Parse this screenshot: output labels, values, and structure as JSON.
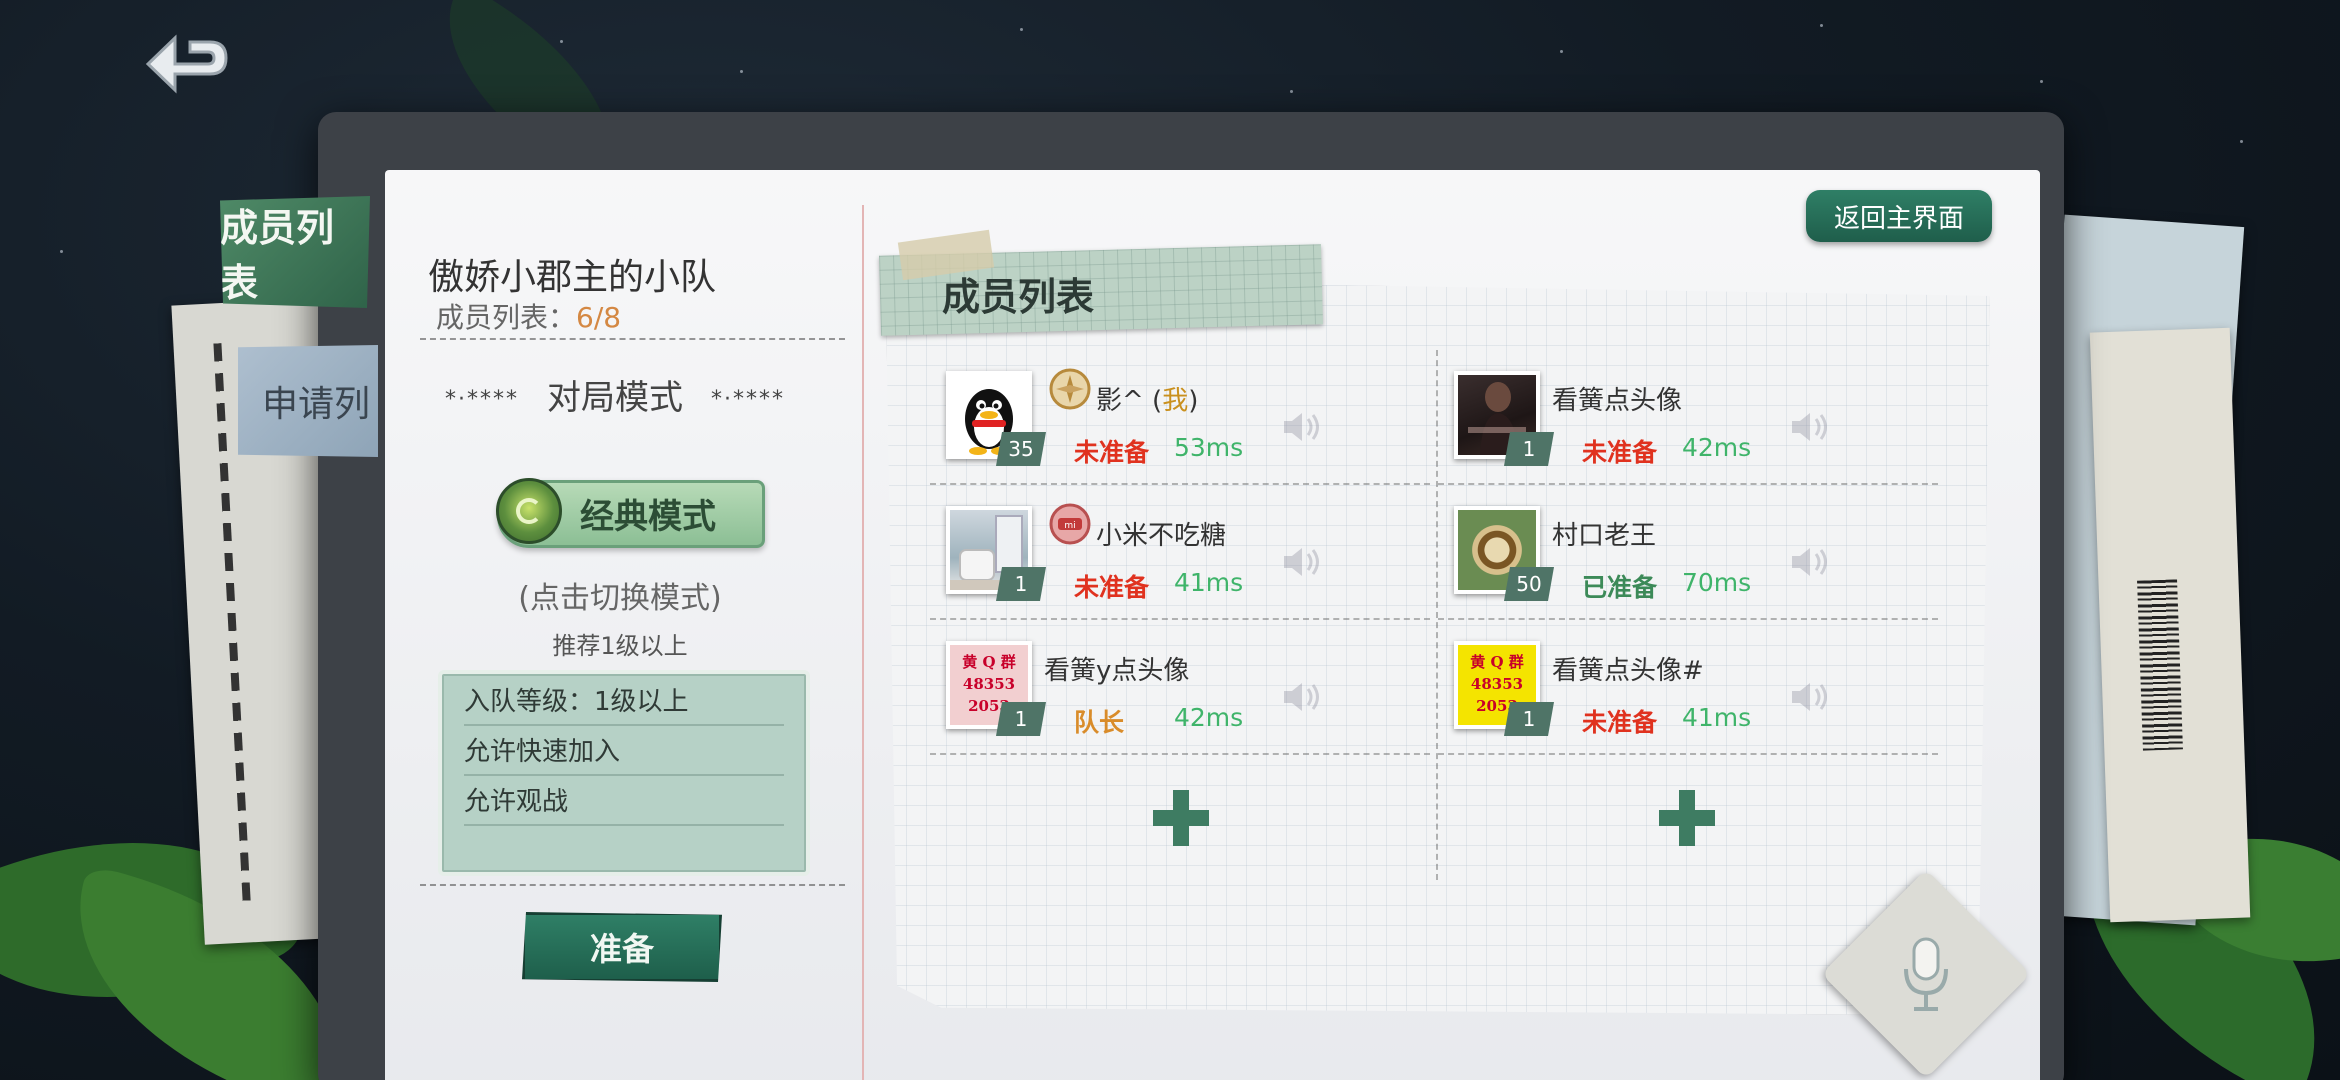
{
  "tabs": {
    "members": "成员列表",
    "apply": "申请列"
  },
  "team": {
    "name": "傲娇小郡主的小队",
    "count_label": "成员列表：",
    "count_value": "6/8"
  },
  "mode": {
    "stars_left": "*·****",
    "title": "对局模式",
    "stars_right": "*·****",
    "current": "经典模式",
    "hint": "(点击切换模式)",
    "recommend": "推荐1级以上"
  },
  "settings": [
    "入队等级：1级以上",
    "允许快速加入",
    "允许观战"
  ],
  "ready_button": "准备",
  "return_main": "返回主界面",
  "card_title": "成员列表",
  "members": [
    {
      "name": "影^ (",
      "me": "我",
      "name_end": ")",
      "level": "35",
      "status": "未准备",
      "ping": "53ms"
    },
    {
      "name": "看簧点头像",
      "level": "1",
      "status": "未准备",
      "ping": "42ms"
    },
    {
      "name": "小米不吃糖",
      "level": "1",
      "status": "未准备",
      "ping": "41ms"
    },
    {
      "name": "村口老王",
      "level": "50",
      "status": "已准备",
      "ping": "70ms"
    },
    {
      "name": "看簧y点头像",
      "level": "1",
      "status": "队长",
      "ping": "42ms"
    },
    {
      "name": "看簧点头像#",
      "level": "1",
      "status": "未准备",
      "ping": "41ms"
    }
  ],
  "ad_avatar": {
    "line1": "黄 Q 群",
    "line2": "48353",
    "line3": "2053"
  },
  "colors": {
    "accent_green": "#2f7f66",
    "not_ready": "#e0321f",
    "ping": "#3fb46a",
    "captain": "#d98c2a"
  },
  "icons": [
    "back-arrow-icon",
    "mode-emblem-icon",
    "speaker-icon",
    "plus-icon",
    "microphone-icon",
    "compass-badge-icon",
    "xiaomi-badge-icon"
  ]
}
